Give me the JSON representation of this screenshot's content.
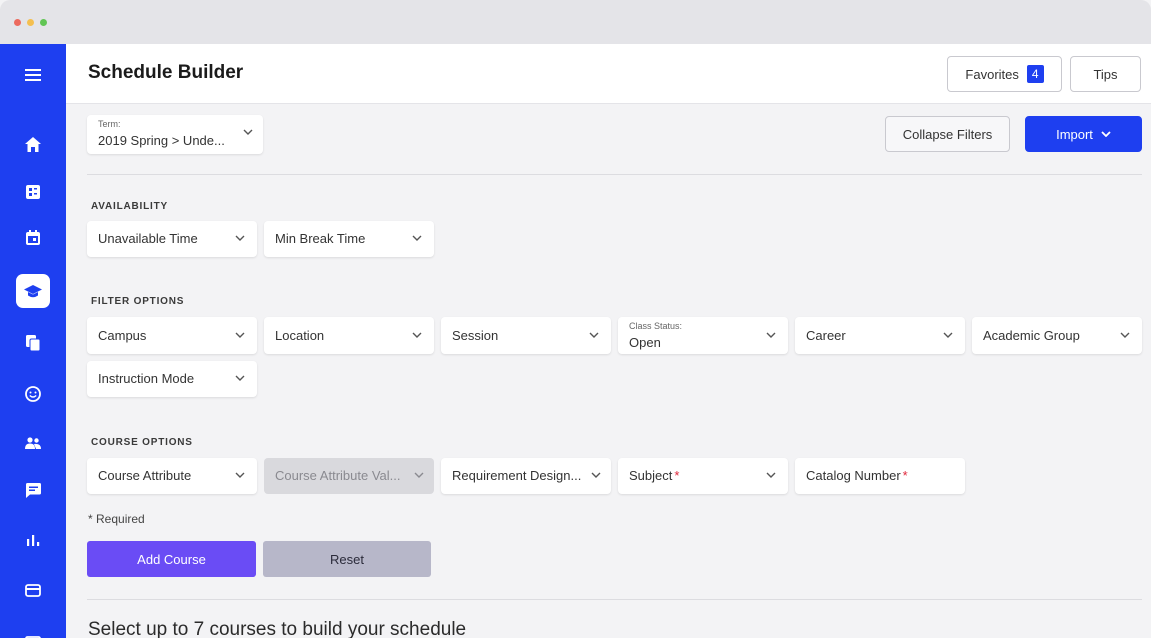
{
  "header": {
    "title": "Schedule Builder",
    "favorites_label": "Favorites",
    "favorites_count": "4",
    "tips_label": "Tips"
  },
  "term": {
    "caption": "Term:",
    "value": "2019 Spring > Unde..."
  },
  "actions": {
    "collapse_label": "Collapse Filters",
    "import_label": "Import"
  },
  "availability": {
    "heading": "AVAILABILITY",
    "fields": [
      "Unavailable Time",
      "Min Break Time"
    ]
  },
  "filters": {
    "heading": "FILTER OPTIONS",
    "campus": "Campus",
    "location": "Location",
    "session": "Session",
    "class_status_caption": "Class Status:",
    "class_status_value": "Open",
    "career": "Career",
    "academic_group": "Academic Group",
    "instruction_mode": "Instruction Mode"
  },
  "course": {
    "heading": "COURSE OPTIONS",
    "attribute": "Course Attribute",
    "attribute_value": "Course Attribute Val...",
    "requirement": "Requirement Design...",
    "subject": "Subject",
    "catalog": "Catalog Number",
    "required_marker": "*",
    "required_note": "* Required"
  },
  "buttons": {
    "add_course": "Add Course",
    "reset": "Reset"
  },
  "footer_text": "Select up to 7 courses to build your schedule",
  "colors": {
    "sidebar": "#1e3ff0",
    "primary_button": "#1e3ff0",
    "add_course": "#6a4cf5",
    "reset": "#b7b7c9",
    "required": "#e0263a"
  },
  "icons": {
    "sidebar": [
      "menu-icon",
      "home-icon",
      "dashboard-icon",
      "calendar-icon",
      "graduation-cap-icon",
      "documents-icon",
      "smiley-icon",
      "people-icon",
      "chat-icon",
      "bar-chart-icon",
      "credit-card-icon"
    ]
  }
}
